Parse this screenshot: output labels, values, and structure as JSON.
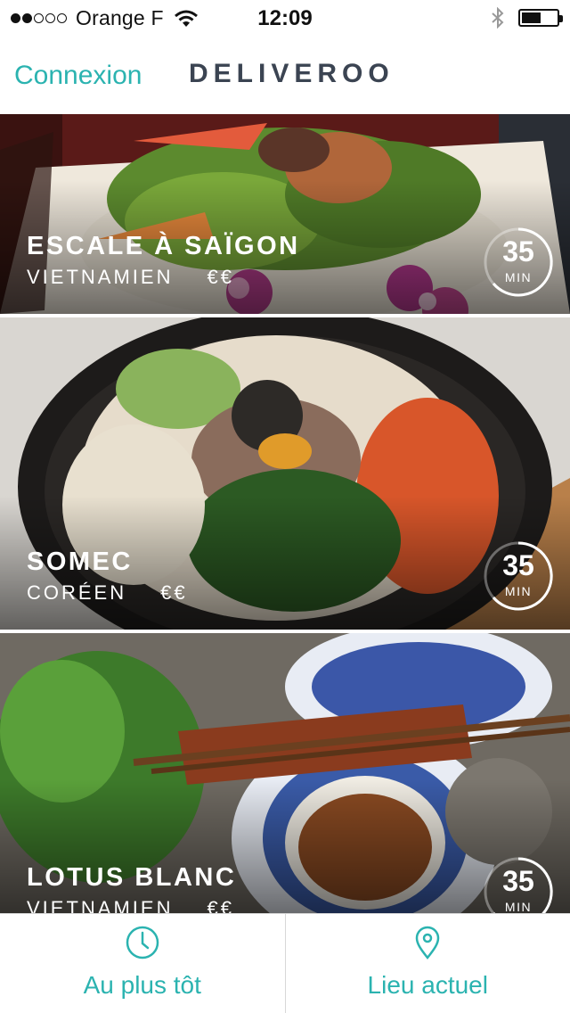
{
  "status_bar": {
    "signal_dots_filled": 2,
    "signal_dots_total": 5,
    "carrier": "Orange F",
    "time": "12:09",
    "battery_level": 0.55,
    "icons": [
      "signal-dots-icon",
      "wifi-icon",
      "bluetooth-icon",
      "battery-icon"
    ]
  },
  "nav": {
    "login_label": "Connexion",
    "brand": "DELIVEROO"
  },
  "restaurants": [
    {
      "name": "ESCALE À SAÏGON",
      "cuisine": "VIETNAMIEN",
      "price": "€€",
      "eta": "35",
      "eta_unit": "MIN",
      "photo": "vietnamese-salad-photo"
    },
    {
      "name": "SOMEC",
      "cuisine": "CORÉEN",
      "price": "€€",
      "eta": "35",
      "eta_unit": "MIN",
      "photo": "bibimbap-photo"
    },
    {
      "name": "LOTUS BLANC",
      "cuisine": "VIETNAMIEN",
      "price": "€€",
      "eta": "35",
      "eta_unit": "MIN",
      "photo": "grilled-skewer-photo"
    }
  ],
  "tabs": [
    {
      "label": "Au plus tôt",
      "icon": "clock-icon"
    },
    {
      "label": "Lieu actuel",
      "icon": "location-pin-icon"
    }
  ],
  "colors": {
    "accent": "#2bb3b0",
    "brand_text": "#3b4452"
  }
}
